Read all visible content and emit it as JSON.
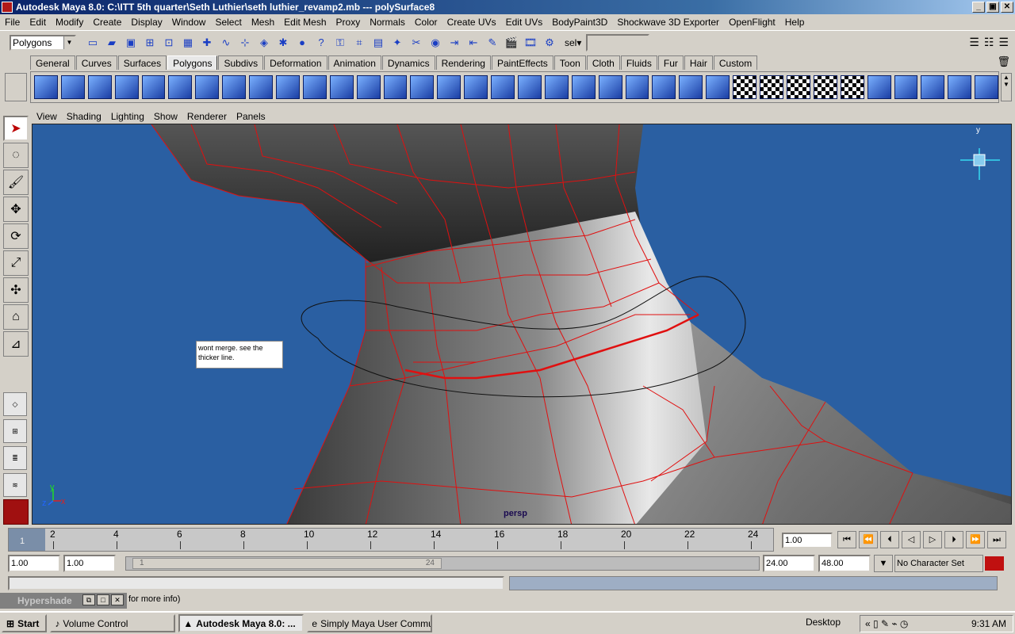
{
  "window": {
    "title": "Autodesk Maya 8.0: C:\\ITT 5th quarter\\Seth Luthier\\seth luthier_revamp2.mb   ---   polySurface8",
    "min": "_",
    "max": "▣",
    "close": "✕"
  },
  "menu": [
    "File",
    "Edit",
    "Modify",
    "Create",
    "Display",
    "Window",
    "Select",
    "Mesh",
    "Edit Mesh",
    "Proxy",
    "Normals",
    "Color",
    "Create UVs",
    "Edit UVs",
    "BodyPaint3D",
    "Shockwave 3D Exporter",
    "OpenFlight",
    "Help"
  ],
  "statusline": {
    "mode": "Polygons",
    "sel_label": "sel▾"
  },
  "shelf_tabs": [
    "General",
    "Curves",
    "Surfaces",
    "Polygons",
    "Subdivs",
    "Deformation",
    "Animation",
    "Dynamics",
    "Rendering",
    "PaintEffects",
    "Toon",
    "Cloth",
    "Fluids",
    "Fur",
    "Hair",
    "Custom"
  ],
  "active_shelf_tab": "Polygons",
  "panel_menu": [
    "View",
    "Shading",
    "Lighting",
    "Show",
    "Renderer",
    "Panels"
  ],
  "viewport": {
    "note": "wont merge.  see the thicker line.",
    "camera": "persp",
    "axis_x": "x",
    "axis_y": "y",
    "axis_z": "z",
    "background": "#2a5fa2"
  },
  "timeslider": {
    "current_frame": "1",
    "ticks": [
      "2",
      "4",
      "6",
      "8",
      "10",
      "12",
      "14",
      "16",
      "18",
      "20",
      "22",
      "24"
    ],
    "current_field": "1.00"
  },
  "range": {
    "start": "1.00",
    "start2": "1.00",
    "range_start": "1",
    "range_end": "24",
    "end": "24.00",
    "end2": "48.00",
    "character_set": "No Character Set"
  },
  "hypershade": {
    "title": "Hypershade",
    "help": "for more info)"
  },
  "taskbar": {
    "start": "Start",
    "tasks": [
      "Volume Control",
      "Autodesk Maya 8.0: ...",
      "Simply Maya User Commu..."
    ],
    "desktop": "Desktop",
    "clock": "9:31 AM"
  }
}
